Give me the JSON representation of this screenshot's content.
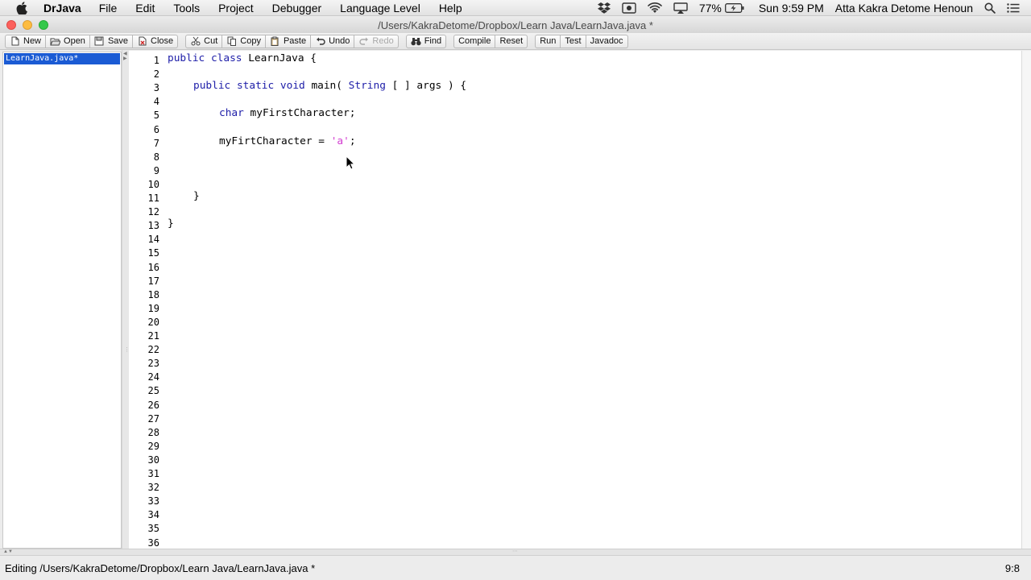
{
  "menubar": {
    "app_name": "DrJava",
    "items": [
      "File",
      "Edit",
      "Tools",
      "Project",
      "Debugger",
      "Language Level",
      "Help"
    ],
    "battery": "77%",
    "clock": "Sun 9:59 PM",
    "user": "Atta Kakra Detome Henoun"
  },
  "window": {
    "title": "/Users/KakraDetome/Dropbox/Learn Java/LearnJava.java *"
  },
  "toolbar": {
    "new": "New",
    "open": "Open",
    "save": "Save",
    "close": "Close",
    "cut": "Cut",
    "copy": "Copy",
    "paste": "Paste",
    "undo": "Undo",
    "redo": "Redo",
    "find": "Find",
    "compile": "Compile",
    "reset": "Reset",
    "run": "Run",
    "test": "Test",
    "javadoc": "Javadoc"
  },
  "documents": [
    "LearnJava.java*"
  ],
  "editor": {
    "line_count": 36,
    "lines": [
      {
        "n": 1,
        "indent": 0,
        "tokens": [
          [
            "kw",
            "public"
          ],
          [
            "t",
            " "
          ],
          [
            "kw",
            "class"
          ],
          [
            "t",
            " LearnJava {"
          ]
        ]
      },
      {
        "n": 3,
        "indent": 1,
        "tokens": [
          [
            "kw",
            "public"
          ],
          [
            "t",
            " "
          ],
          [
            "kw",
            "static"
          ],
          [
            "t",
            " "
          ],
          [
            "kw",
            "void"
          ],
          [
            "t",
            " main( "
          ],
          [
            "kw",
            "String"
          ],
          [
            "t",
            " [ ] args ) {"
          ]
        ]
      },
      {
        "n": 5,
        "indent": 2,
        "tokens": [
          [
            "kw",
            "char"
          ],
          [
            "t",
            " myFirstCharacter;"
          ]
        ]
      },
      {
        "n": 7,
        "indent": 2,
        "tokens": [
          [
            "t",
            "myFirtCharacter = "
          ],
          [
            "str",
            "'a'"
          ],
          [
            "t",
            ";"
          ]
        ]
      },
      {
        "n": 11,
        "indent": 1,
        "tokens": [
          [
            "t",
            "}"
          ]
        ]
      },
      {
        "n": 13,
        "indent": 0,
        "tokens": [
          [
            "t",
            "}"
          ]
        ]
      }
    ]
  },
  "status": {
    "message": "Editing /Users/KakraDetome/Dropbox/Learn Java/LearnJava.java *",
    "cursor_position": "9:8"
  },
  "colors": {
    "keyword": "#1d1da8",
    "char_literal": "#d23bd0",
    "selection": "#1b5bd4"
  }
}
